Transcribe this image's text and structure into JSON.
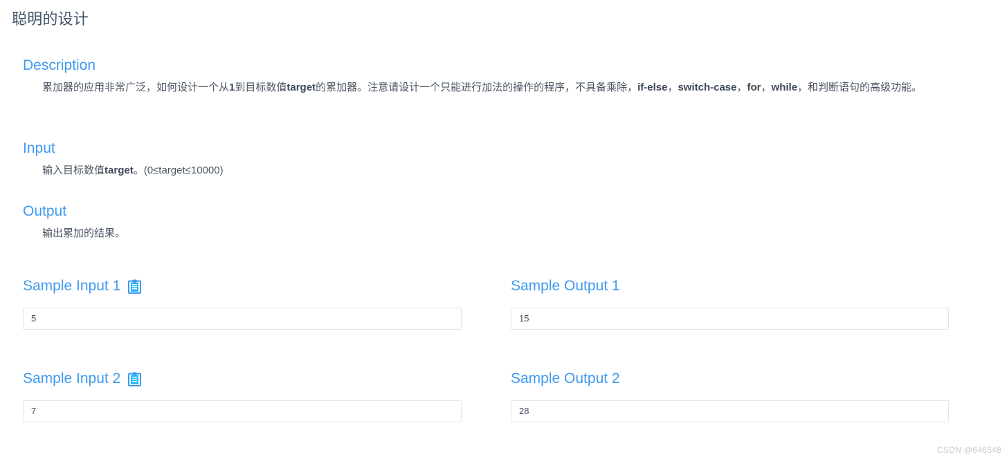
{
  "page": {
    "title": "聪明的设计",
    "accent_color": "#3f9aef",
    "title_color": "#42526a",
    "body_text_color": "#4b5563",
    "box_border_color": "#e3e5e8",
    "background_color": "#ffffff"
  },
  "sections": {
    "description": {
      "heading": "Description",
      "text_parts": [
        {
          "text": "累加器的应用非常广泛，如何设计一个从",
          "bold": false
        },
        {
          "text": "1",
          "bold": true
        },
        {
          "text": "到目标数值",
          "bold": false
        },
        {
          "text": "target",
          "bold": true
        },
        {
          "text": "的累加器。注意请设计一个只能进行加法的操作的程序，不具备乘除，",
          "bold": false
        },
        {
          "text": "if-else",
          "bold": true
        },
        {
          "text": "，",
          "bold": false
        },
        {
          "text": "switch-case",
          "bold": true
        },
        {
          "text": "，",
          "bold": false
        },
        {
          "text": "for",
          "bold": true
        },
        {
          "text": "，",
          "bold": false
        },
        {
          "text": "while",
          "bold": true
        },
        {
          "text": "，和判断语句的高级功能。",
          "bold": false
        }
      ],
      "plain_text": "累加器的应用非常广泛，如何设计一个从1到目标数值target的累加器。注意请设计一个只能进行加法的操作的程序，不具备乘除，if-else，switch-case，for，while，和判断语句的高级功能。"
    },
    "input": {
      "heading": "Input",
      "text_parts": [
        {
          "text": "输入目标数值",
          "bold": false
        },
        {
          "text": "target",
          "bold": true
        },
        {
          "text": "。(0≤target≤10000)",
          "bold": false
        }
      ],
      "plain_text": "输入目标数值target。(0≤target≤10000)"
    },
    "output": {
      "heading": "Output",
      "text_parts": [
        {
          "text": "输出累加的结果。",
          "bold": false
        }
      ],
      "plain_text": "输出累加的结果。"
    }
  },
  "samples": [
    {
      "input_heading": "Sample Input 1",
      "input_value": "5",
      "input_has_copy_icon": true,
      "copy_icon_name": "clipboard-copy-icon",
      "output_heading": "Sample Output 1",
      "output_value": "15",
      "output_has_copy_icon": false
    },
    {
      "input_heading": "Sample Input 2",
      "input_value": "7",
      "input_has_copy_icon": true,
      "copy_icon_name": "clipboard-copy-icon",
      "output_heading": "Sample Output 2",
      "output_value": "28",
      "output_has_copy_icon": false
    }
  ],
  "watermark": {
    "text": "CSDN @646548"
  }
}
